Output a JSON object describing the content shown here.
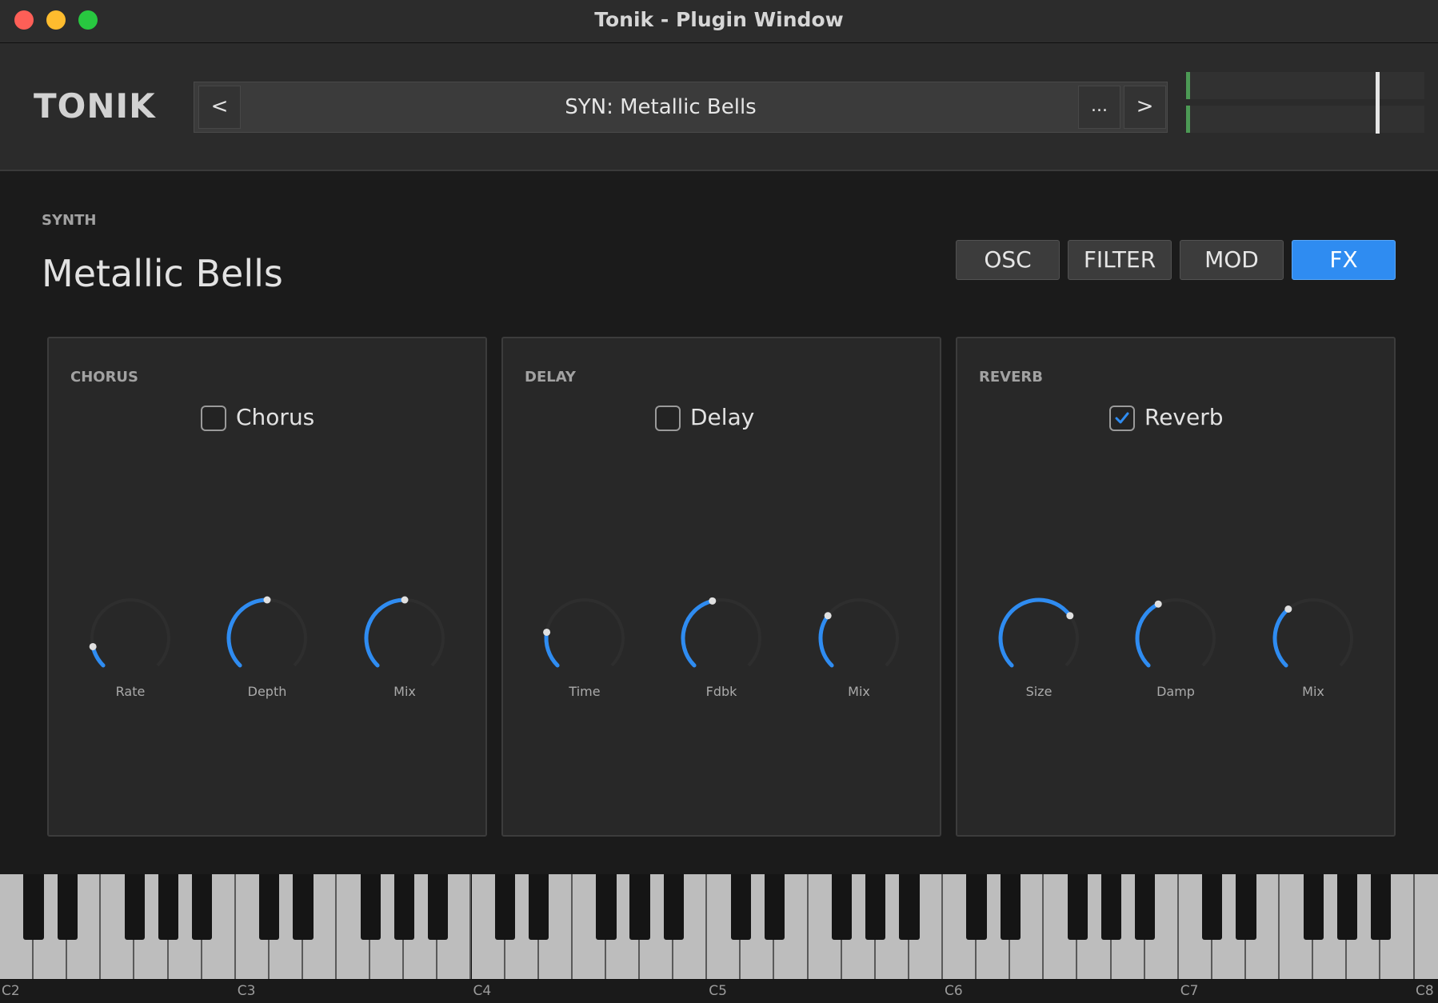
{
  "window": {
    "title": "Tonik - Plugin Window"
  },
  "header": {
    "logo": "TONIK",
    "preset": {
      "prev_label": "<",
      "name": "SYN: Metallic Bells",
      "more_label": "...",
      "next_label": ">"
    }
  },
  "main": {
    "section_label": "SYNTH",
    "patch_name": "Metallic Bells",
    "tabs": [
      {
        "label": "OSC",
        "active": false
      },
      {
        "label": "FILTER",
        "active": false
      },
      {
        "label": "MOD",
        "active": false
      },
      {
        "label": "FX",
        "active": true
      }
    ],
    "panels": [
      {
        "title": "CHORUS",
        "toggle": {
          "label": "Chorus",
          "checked": false
        },
        "knobs": [
          {
            "label": "Rate",
            "value": 0.12
          },
          {
            "label": "Depth",
            "value": 0.5
          },
          {
            "label": "Mix",
            "value": 0.5
          }
        ]
      },
      {
        "title": "DELAY",
        "toggle": {
          "label": "Delay",
          "checked": false
        },
        "knobs": [
          {
            "label": "Time",
            "value": 0.2
          },
          {
            "label": "Fdbk",
            "value": 0.45
          },
          {
            "label": "Mix",
            "value": 0.3
          }
        ]
      },
      {
        "title": "REVERB",
        "toggle": {
          "label": "Reverb",
          "checked": true
        },
        "knobs": [
          {
            "label": "Size",
            "value": 0.7
          },
          {
            "label": "Damp",
            "value": 0.4
          },
          {
            "label": "Mix",
            "value": 0.35
          }
        ]
      }
    ]
  },
  "keyboard": {
    "octave_labels": [
      "C2",
      "C3",
      "C4",
      "C5",
      "C6",
      "C7",
      "C8"
    ]
  },
  "colors": {
    "accent": "#2f8cf1",
    "meter_level": "#4c9a55",
    "background": "#1b1b1b",
    "panel": "#282828"
  }
}
